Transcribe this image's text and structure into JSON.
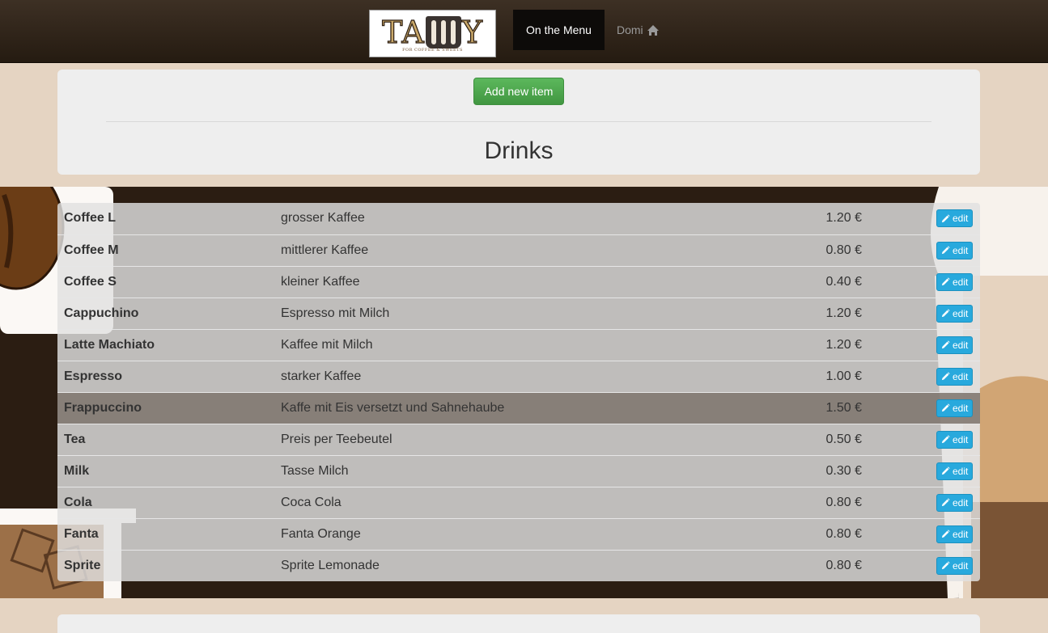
{
  "navbar": {
    "brand_letters_left": "TA",
    "brand_letters_right": "Y",
    "brand_subtitle": "FOR COFFEE & SWEETS",
    "active_tab": "On the Menu",
    "user_label": "Domi"
  },
  "header": {
    "add_button": "Add new item",
    "section_title": "Drinks"
  },
  "table": {
    "edit_label": "edit",
    "rows": [
      {
        "name": "Coffee L",
        "description": "grosser Kaffee",
        "price": "1.20 €"
      },
      {
        "name": "Coffee M",
        "description": "mittlerer Kaffee",
        "price": "0.80 €"
      },
      {
        "name": "Coffee S",
        "description": "kleiner Kaffee",
        "price": "0.40 €"
      },
      {
        "name": "Cappuchino",
        "description": "Espresso mit Milch",
        "price": "1.20 €"
      },
      {
        "name": "Latte Machiato",
        "description": "Kaffee mit Milch",
        "price": "1.20 €"
      },
      {
        "name": "Espresso",
        "description": "starker Kaffee",
        "price": "1.00 €"
      },
      {
        "name": "Frappuccino",
        "description": "Kaffe mit Eis versetzt und Sahnehaube",
        "price": "1.50 €"
      },
      {
        "name": "Tea",
        "description": "Preis per Teebeutel",
        "price": "0.50 €"
      },
      {
        "name": "Milk",
        "description": "Tasse Milch",
        "price": "0.30 €"
      },
      {
        "name": "Cola",
        "description": "Coca Cola",
        "price": "0.80 €"
      },
      {
        "name": "Fanta",
        "description": "Fanta Orange",
        "price": "0.80 €"
      },
      {
        "name": "Sprite",
        "description": "Sprite Lemonade",
        "price": "0.80 €"
      }
    ]
  },
  "colors": {
    "navbar": "#2f2419",
    "page_background": "#e5d4c2",
    "add_button": "#5cb85c",
    "edit_button": "#28a9dd",
    "highlight_row": "#86796f"
  },
  "icons": {
    "user_link": "home-icon",
    "edit_button": "pencil-icon"
  }
}
